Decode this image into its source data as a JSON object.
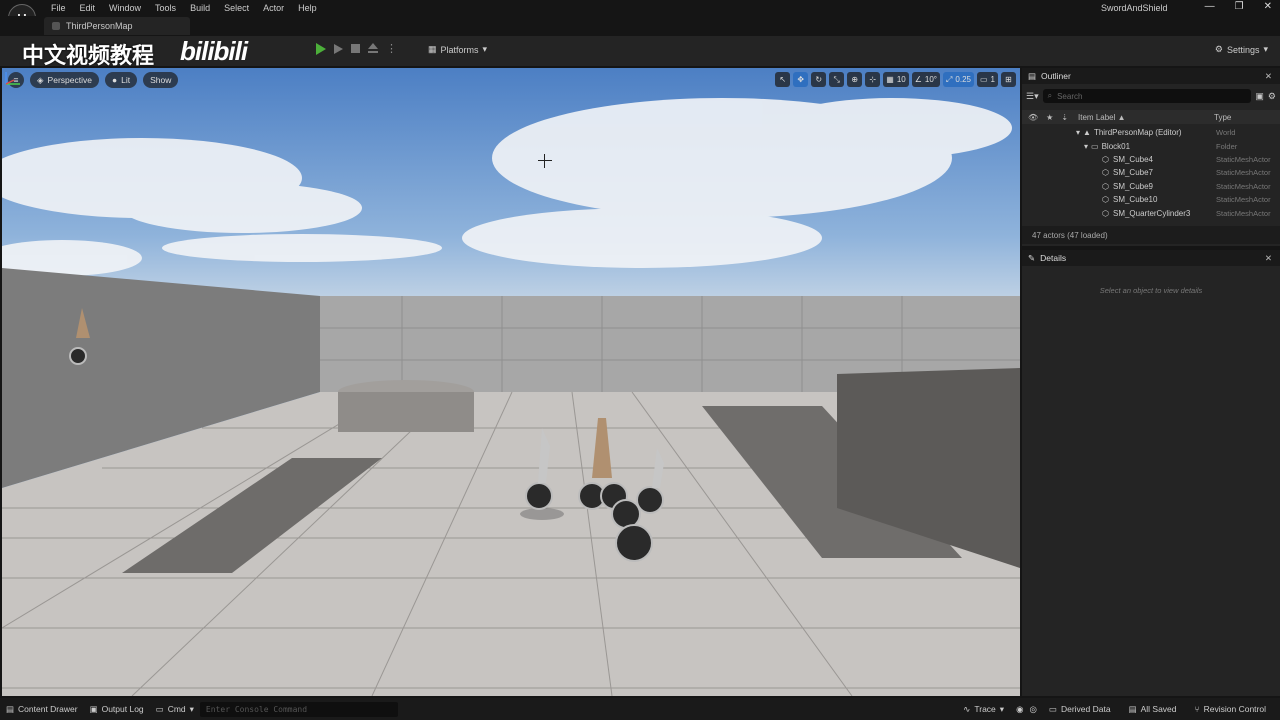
{
  "menu": [
    "File",
    "Edit",
    "Window",
    "Tools",
    "Build",
    "Select",
    "Actor",
    "Help"
  ],
  "project_name": "SwordAndShield",
  "map_tab": "ThirdPersonMap",
  "watermark": {
    "text": "中文视频教程",
    "logo": "bilibili"
  },
  "toolbar": {
    "platforms": "Platforms",
    "settings": "Settings"
  },
  "viewport": {
    "perspective": "Perspective",
    "lit": "Lit",
    "show": "Show",
    "grid_snap": "10",
    "rotation_snap": "10°",
    "scale_snap": "0.25",
    "camera_speed": "1"
  },
  "outliner": {
    "title": "Outliner",
    "search_placeholder": "Search",
    "col_label": "Item Label ▲",
    "col_type": "Type",
    "items": [
      {
        "label": "ThirdPersonMap (Editor)",
        "type": "World"
      },
      {
        "label": "Block01",
        "type": "Folder"
      },
      {
        "label": "SM_Cube4",
        "type": "StaticMeshActor"
      },
      {
        "label": "SM_Cube7",
        "type": "StaticMeshActor"
      },
      {
        "label": "SM_Cube9",
        "type": "StaticMeshActor"
      },
      {
        "label": "SM_Cube10",
        "type": "StaticMeshActor"
      },
      {
        "label": "SM_QuarterCylinder3",
        "type": "StaticMeshActor"
      }
    ],
    "actors_count": "47 actors (47 loaded)"
  },
  "details": {
    "title": "Details",
    "empty_text": "Select an object to view details"
  },
  "statusbar": {
    "content_drawer": "Content Drawer",
    "output_log": "Output Log",
    "cmd": "Cmd",
    "console_placeholder": "Enter Console Command",
    "trace": "Trace",
    "derived_data": "Derived Data",
    "all_saved": "All Saved",
    "revision_control": "Revision Control"
  }
}
